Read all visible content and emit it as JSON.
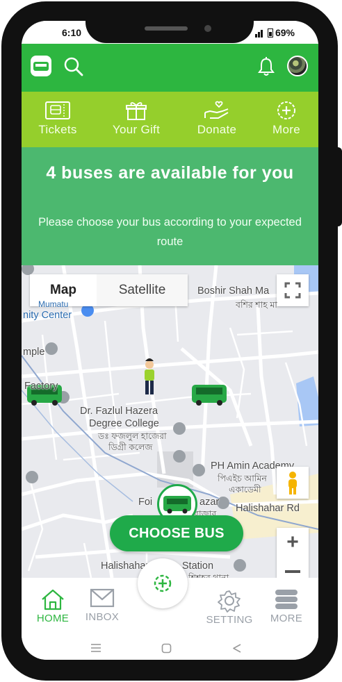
{
  "status_bar": {
    "time": "6:10",
    "battery": "69%"
  },
  "quick_menu": [
    {
      "label": "Tickets",
      "icon": "ticket-icon"
    },
    {
      "label": "Your Gift",
      "icon": "gift-icon"
    },
    {
      "label": "Donate",
      "icon": "donate-hand-icon"
    },
    {
      "label": "More",
      "icon": "plus-circle-icon"
    }
  ],
  "banner": {
    "title": "4 buses are available for you",
    "subtitle": "Please choose your bus according to your expected route"
  },
  "map": {
    "toggle": {
      "map": "Map",
      "satellite": "Satellite"
    },
    "labels": {
      "boshir": "Boshir Shah Ma",
      "boshir_bn": "বশির শাহ মা",
      "community": "Mumatu",
      "community2": "nity Center",
      "temple": "mple",
      "factory": "Factory",
      "college1": "Dr. Fazlul Hazera",
      "college2": "Degree College",
      "college_bn1": "ডঃ ফজলুল হাজেরা",
      "college_bn2": "ডিগ্রী কলেজ",
      "academy": "PH Amin Academy",
      "academy_bn1": "পিএইচ আমিন",
      "academy_bn2": "একাডেমী",
      "bazar": "Foi",
      "bazar2": "azar",
      "bazar_bn": "বাজার",
      "road": "Halishahar Rd",
      "station": "Halishahar Police Station",
      "station_bn": "শিশহর থানা"
    },
    "choose_bus": "CHOOSE BUS"
  },
  "bottom_nav": [
    {
      "label": "HOME",
      "icon": "home-icon",
      "active": true
    },
    {
      "label": "INBOX",
      "icon": "mail-icon",
      "active": false
    },
    {
      "label": "SETTING",
      "icon": "gear-icon",
      "active": false
    },
    {
      "label": "MORE",
      "icon": "menu-stack-icon",
      "active": false
    }
  ],
  "colors": {
    "primary": "#2db640",
    "lime": "#95cf2c",
    "banner": "#4cb86f",
    "button": "#1faa4a"
  }
}
